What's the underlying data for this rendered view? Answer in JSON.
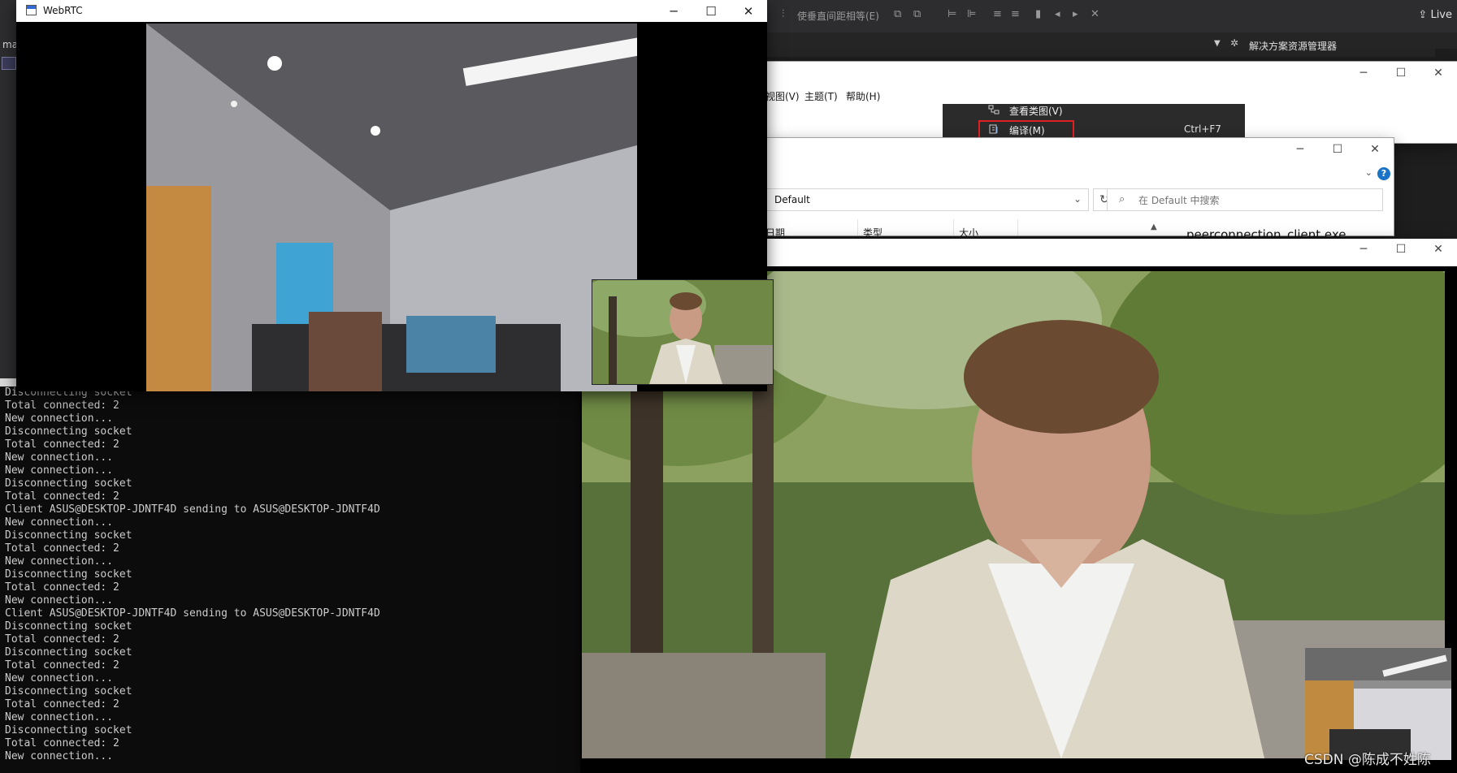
{
  "vs": {
    "toolbar_text": "使垂直间距相等(E)",
    "live_label": "Live",
    "solution_explorer_title": "解决方案资源管理器",
    "left_label": "ma"
  },
  "menu_window": {
    "menus": [
      "视图(V)",
      "主题(T)",
      "帮助(H)"
    ],
    "context_menu": {
      "items": [
        {
          "label": "查看类图(V)",
          "shortcut": ""
        },
        {
          "label": "编译(M)",
          "shortcut": "Ctrl+F7"
        }
      ]
    }
  },
  "explorer": {
    "address_value": "Default",
    "search_placeholder": "在 Default 中搜索",
    "columns": [
      "日期",
      "类型",
      "大小"
    ],
    "file_name": "peerconnection_client.exe",
    "help_glyph": "?"
  },
  "webrtc_window": {
    "title": "WebRTC"
  },
  "console": {
    "lines": [
      "Disconnecting socket",
      "Total connected: 2",
      "New connection...",
      "Disconnecting socket",
      "Total connected: 2",
      "New connection...",
      "New connection...",
      "Disconnecting socket",
      "Total connected: 2",
      "Client ASUS@DESKTOP-JDNTF4D sending to ASUS@DESKTOP-JDNTF4D",
      "New connection...",
      "Disconnecting socket",
      "Total connected: 2",
      "New connection...",
      "Disconnecting socket",
      "Total connected: 2",
      "New connection...",
      "Client ASUS@DESKTOP-JDNTF4D sending to ASUS@DESKTOP-JDNTF4D",
      "Disconnecting socket",
      "Total connected: 2",
      "Disconnecting socket",
      "Total connected: 2",
      "New connection...",
      "Disconnecting socket",
      "Total connected: 2",
      "New connection...",
      "Disconnecting socket",
      "Total connected: 2",
      "New connection..."
    ]
  },
  "watermark": "CSDN @陈成不姓陈"
}
